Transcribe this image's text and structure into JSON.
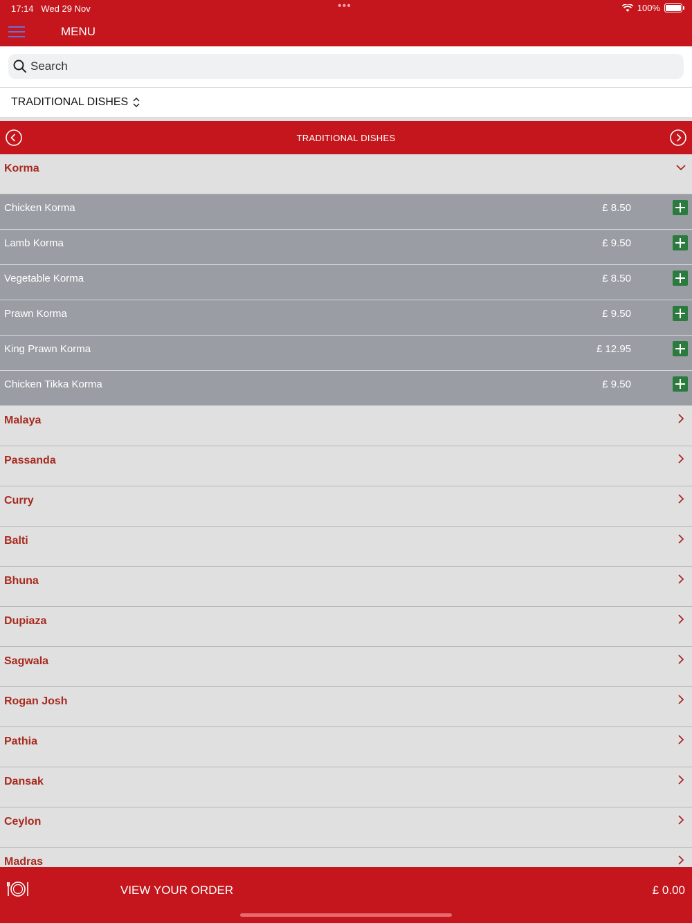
{
  "status": {
    "time": "17:14",
    "date": "Wed 29 Nov",
    "battery": "100%"
  },
  "header": {
    "title": "MENU"
  },
  "search": {
    "placeholder": "Search"
  },
  "category_select": {
    "label": "TRADITIONAL DISHES"
  },
  "category_bar": {
    "title": "TRADITIONAL DISHES"
  },
  "expanded_section": {
    "name": "Korma",
    "items": [
      {
        "name": "Chicken Korma",
        "price": "£ 8.50"
      },
      {
        "name": "Lamb Korma",
        "price": "£ 9.50"
      },
      {
        "name": "Vegetable Korma",
        "price": "£ 8.50"
      },
      {
        "name": "Prawn Korma",
        "price": "£ 9.50"
      },
      {
        "name": "King Prawn Korma",
        "price": "£ 12.95"
      },
      {
        "name": "Chicken Tikka Korma",
        "price": "£ 9.50"
      }
    ]
  },
  "sections": [
    "Malaya",
    "Passanda",
    "Curry",
    "Balti",
    "Bhuna",
    "Dupiaza",
    "Sagwala",
    "Rogan Josh",
    "Pathia",
    "Dansak",
    "Ceylon",
    "Madras"
  ],
  "footer": {
    "view_order": "VIEW YOUR ORDER",
    "total": "£ 0.00"
  },
  "colors": {
    "brand": "#c4161c",
    "section_text": "#a8291e",
    "item_bg": "#9a9da3",
    "add_button": "#2b7a3e"
  }
}
